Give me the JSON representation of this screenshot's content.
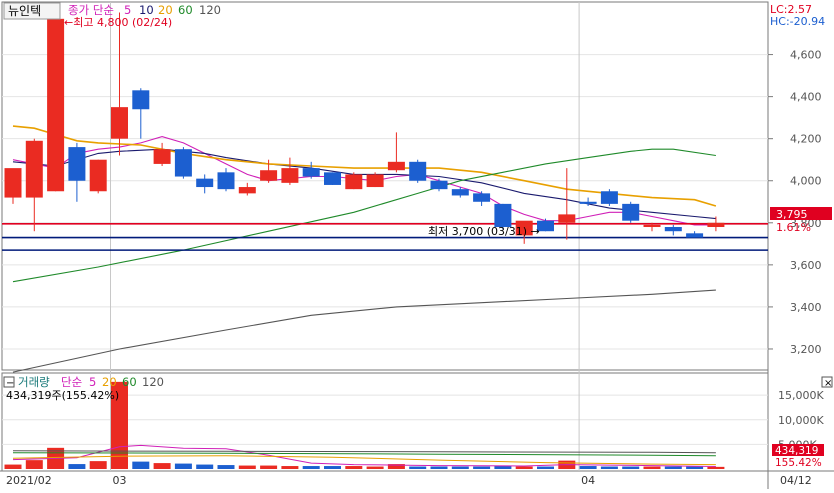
{
  "header": {
    "stock_name": "뉴인텍",
    "ma_label": "종가 단순",
    "ma_periods": [
      "5",
      "10",
      "20",
      "60",
      "120"
    ],
    "lc": "LC:2.57",
    "hc": "HC:-20.94"
  },
  "volume_header": {
    "label": "거래량",
    "ma_label": "단순",
    "ma_periods": [
      "5",
      "20",
      "60",
      "120"
    ],
    "current": "434,319주(155.42%)"
  },
  "annotations": {
    "high": "←최고 4,800 (02/24)",
    "low": "최저 3,700 (03/31) →",
    "current_price": "3,795",
    "current_pct": "1.61%",
    "current_volume": "434,319",
    "current_volume_pct": "155.42%"
  },
  "x_axis_labels": [
    {
      "label": "2021/02",
      "index": 0
    },
    {
      "label": "03",
      "index": 5
    },
    {
      "label": "04",
      "index": 27
    },
    {
      "label": "04/12",
      "index": 36
    }
  ],
  "colors": {
    "up": "#ea2b22",
    "down": "#1c5fd0",
    "ma5": "#d020b8",
    "ma10": "#1a1a6e",
    "ma20": "#e8a000",
    "ma60": "#1f8a2a",
    "ma120": "#555555",
    "hline_red": "#e00020",
    "hline_navy": "#001a7a"
  },
  "chart_data": {
    "type": "candlestick",
    "price_axis": {
      "ticks": [
        3200,
        3400,
        3600,
        3800,
        4000,
        4200,
        4400,
        4600
      ],
      "ylim": [
        3100,
        4850
      ]
    },
    "volume_axis": {
      "ticks": [
        "5,000K",
        "10,000K",
        "15,000K"
      ],
      "tick_values": [
        5000,
        10000,
        15000
      ],
      "ylim": [
        0,
        19500
      ]
    },
    "candles": [
      {
        "o": 3920,
        "h": 4050,
        "l": 3890,
        "c": 4060
      },
      {
        "o": 3920,
        "h": 4200,
        "l": 3760,
        "c": 4190
      },
      {
        "o": 3950,
        "h": 4780,
        "l": 3950,
        "c": 4770
      },
      {
        "o": 4160,
        "h": 4180,
        "l": 3900,
        "c": 4000
      },
      {
        "o": 3950,
        "h": 4100,
        "l": 3940,
        "c": 4100
      },
      {
        "o": 4200,
        "h": 4800,
        "l": 4120,
        "c": 4350
      },
      {
        "o": 4430,
        "h": 4440,
        "l": 4200,
        "c": 4340
      },
      {
        "o": 4080,
        "h": 4180,
        "l": 4070,
        "c": 4150
      },
      {
        "o": 4150,
        "h": 4160,
        "l": 4010,
        "c": 4020
      },
      {
        "o": 4010,
        "h": 4030,
        "l": 3940,
        "c": 3970
      },
      {
        "o": 4040,
        "h": 4060,
        "l": 3950,
        "c": 3960
      },
      {
        "o": 3940,
        "h": 3990,
        "l": 3930,
        "c": 3970
      },
      {
        "o": 4000,
        "h": 4100,
        "l": 3990,
        "c": 4050
      },
      {
        "o": 3990,
        "h": 4110,
        "l": 3980,
        "c": 4060
      },
      {
        "o": 4060,
        "h": 4090,
        "l": 4010,
        "c": 4020
      },
      {
        "o": 4040,
        "h": 4040,
        "l": 3980,
        "c": 3980
      },
      {
        "o": 3960,
        "h": 4040,
        "l": 3960,
        "c": 4030
      },
      {
        "o": 3970,
        "h": 4040,
        "l": 3970,
        "c": 4030
      },
      {
        "o": 4050,
        "h": 4230,
        "l": 4040,
        "c": 4090
      },
      {
        "o": 4090,
        "h": 4100,
        "l": 3990,
        "c": 4000
      },
      {
        "o": 4000,
        "h": 4010,
        "l": 3950,
        "c": 3960
      },
      {
        "o": 3960,
        "h": 3970,
        "l": 3920,
        "c": 3930
      },
      {
        "o": 3940,
        "h": 3950,
        "l": 3880,
        "c": 3900
      },
      {
        "o": 3890,
        "h": 3890,
        "l": 3770,
        "c": 3780
      },
      {
        "o": 3740,
        "h": 3800,
        "l": 3700,
        "c": 3810
      },
      {
        "o": 3810,
        "h": 3820,
        "l": 3760,
        "c": 3760
      },
      {
        "o": 3800,
        "h": 4060,
        "l": 3720,
        "c": 3840
      },
      {
        "o": 3900,
        "h": 3920,
        "l": 3880,
        "c": 3890
      },
      {
        "o": 3950,
        "h": 3960,
        "l": 3880,
        "c": 3890
      },
      {
        "o": 3890,
        "h": 3900,
        "l": 3800,
        "c": 3810
      },
      {
        "o": 3780,
        "h": 3800,
        "l": 3760,
        "c": 3790
      },
      {
        "o": 3780,
        "h": 3790,
        "l": 3740,
        "c": 3760
      },
      {
        "o": 3750,
        "h": 3760,
        "l": 3730,
        "c": 3730
      },
      {
        "o": 3780,
        "h": 3830,
        "l": 3760,
        "c": 3800
      }
    ],
    "volumes": [
      900,
      1800,
      4300,
      1000,
      1600,
      17700,
      1500,
      1200,
      1100,
      900,
      800,
      700,
      700,
      600,
      600,
      600,
      600,
      500,
      1000,
      500,
      500,
      500,
      500,
      600,
      500,
      500,
      1700,
      600,
      500,
      500,
      500,
      500,
      500,
      434
    ],
    "moving_averages": [
      {
        "name": "5",
        "points": [
          [
            0,
            4100
          ],
          [
            1,
            4080
          ],
          [
            2,
            4060
          ],
          [
            3,
            4130
          ],
          [
            4,
            4150
          ],
          [
            5,
            4160
          ],
          [
            6,
            4180
          ],
          [
            7,
            4210
          ],
          [
            8,
            4180
          ],
          [
            9,
            4130
          ],
          [
            10,
            4080
          ],
          [
            11,
            4030
          ],
          [
            12,
            4000
          ],
          [
            13,
            4010
          ],
          [
            14,
            4020
          ],
          [
            15,
            4020
          ],
          [
            16,
            4010
          ],
          [
            17,
            4000
          ],
          [
            18,
            4020
          ],
          [
            19,
            4030
          ],
          [
            20,
            4000
          ],
          [
            21,
            3970
          ],
          [
            22,
            3940
          ],
          [
            23,
            3880
          ],
          [
            24,
            3840
          ],
          [
            25,
            3810
          ],
          [
            26,
            3810
          ],
          [
            27,
            3830
          ],
          [
            28,
            3850
          ],
          [
            29,
            3850
          ],
          [
            30,
            3830
          ],
          [
            31,
            3810
          ],
          [
            32,
            3790
          ],
          [
            33,
            3790
          ]
        ]
      },
      {
        "name": "10",
        "points": [
          [
            0,
            4090
          ],
          [
            2,
            4070
          ],
          [
            4,
            4130
          ],
          [
            5,
            4140
          ],
          [
            7,
            4150
          ],
          [
            9,
            4130
          ],
          [
            10,
            4110
          ],
          [
            12,
            4080
          ],
          [
            14,
            4060
          ],
          [
            16,
            4030
          ],
          [
            18,
            4030
          ],
          [
            20,
            4020
          ],
          [
            22,
            3990
          ],
          [
            24,
            3940
          ],
          [
            26,
            3910
          ],
          [
            28,
            3870
          ],
          [
            30,
            3850
          ],
          [
            32,
            3830
          ],
          [
            33,
            3820
          ]
        ]
      },
      {
        "name": "20",
        "points": [
          [
            0,
            4260
          ],
          [
            1,
            4250
          ],
          [
            2,
            4220
          ],
          [
            3,
            4190
          ],
          [
            4,
            4180
          ],
          [
            6,
            4170
          ],
          [
            8,
            4130
          ],
          [
            10,
            4100
          ],
          [
            12,
            4080
          ],
          [
            14,
            4070
          ],
          [
            16,
            4060
          ],
          [
            18,
            4060
          ],
          [
            20,
            4060
          ],
          [
            22,
            4040
          ],
          [
            24,
            4000
          ],
          [
            26,
            3960
          ],
          [
            28,
            3940
          ],
          [
            30,
            3920
          ],
          [
            32,
            3910
          ],
          [
            33,
            3880
          ]
        ]
      },
      {
        "name": "60",
        "points": [
          [
            0,
            3520
          ],
          [
            4,
            3590
          ],
          [
            8,
            3670
          ],
          [
            12,
            3760
          ],
          [
            16,
            3850
          ],
          [
            19,
            3940
          ],
          [
            21,
            4000
          ],
          [
            23,
            4040
          ],
          [
            25,
            4080
          ],
          [
            27,
            4110
          ],
          [
            29,
            4140
          ],
          [
            30,
            4150
          ],
          [
            31,
            4150
          ],
          [
            33,
            4120
          ]
        ]
      },
      {
        "name": "120",
        "points": [
          [
            0,
            3090
          ],
          [
            5,
            3200
          ],
          [
            10,
            3290
          ],
          [
            14,
            3360
          ],
          [
            18,
            3400
          ],
          [
            22,
            3420
          ],
          [
            26,
            3440
          ],
          [
            30,
            3460
          ],
          [
            33,
            3480
          ]
        ]
      }
    ],
    "volume_moving_averages": [
      {
        "name": "5",
        "points": [
          [
            0,
            1900
          ],
          [
            3,
            2300
          ],
          [
            5,
            4500
          ],
          [
            6,
            4800
          ],
          [
            8,
            4200
          ],
          [
            10,
            4100
          ],
          [
            12,
            2800
          ],
          [
            14,
            1200
          ],
          [
            16,
            900
          ],
          [
            18,
            800
          ],
          [
            20,
            700
          ],
          [
            22,
            650
          ],
          [
            24,
            600
          ],
          [
            26,
            900
          ],
          [
            28,
            800
          ],
          [
            30,
            700
          ],
          [
            33,
            500
          ]
        ]
      },
      {
        "name": "20",
        "points": [
          [
            0,
            2200
          ],
          [
            5,
            2600
          ],
          [
            10,
            2700
          ],
          [
            15,
            2400
          ],
          [
            20,
            1800
          ],
          [
            25,
            1300
          ],
          [
            30,
            1000
          ],
          [
            33,
            900
          ]
        ]
      },
      {
        "name": "60",
        "points": [
          [
            0,
            3300
          ],
          [
            10,
            3200
          ],
          [
            20,
            3000
          ],
          [
            30,
            2800
          ],
          [
            33,
            2700
          ]
        ]
      },
      {
        "name": "120",
        "points": [
          [
            0,
            3700
          ],
          [
            10,
            3600
          ],
          [
            20,
            3500
          ],
          [
            30,
            3400
          ],
          [
            33,
            3300
          ]
        ]
      }
    ],
    "horizontal_lines": [
      {
        "value": 3795,
        "color": "red"
      },
      {
        "value": 3730,
        "color": "navy"
      },
      {
        "value": 3670,
        "color": "navy"
      }
    ]
  }
}
